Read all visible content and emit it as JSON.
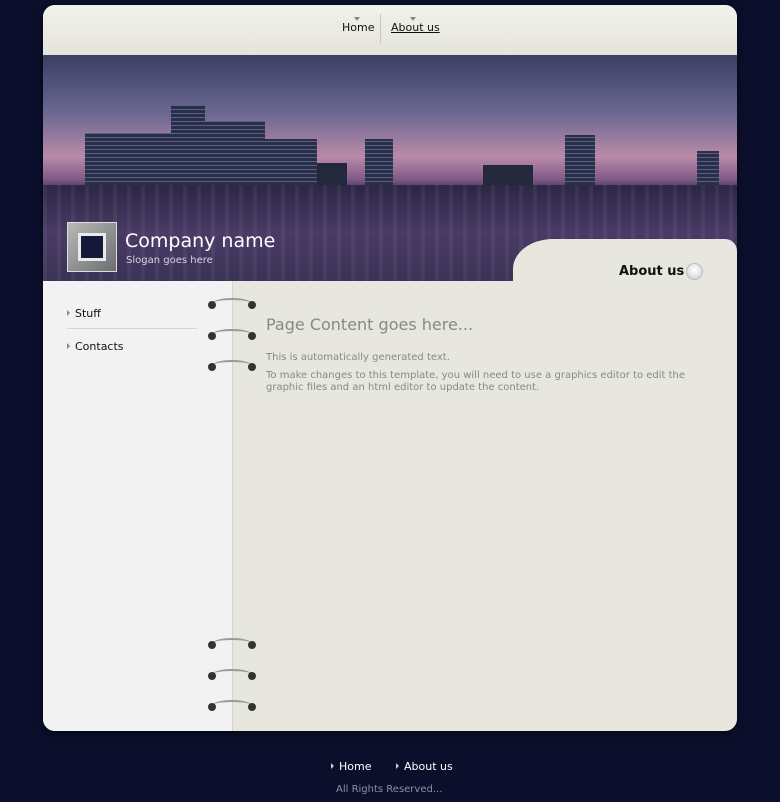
{
  "nav": {
    "home": "Home",
    "about": "About us"
  },
  "brand": {
    "company_name": "Company name",
    "slogan": "Slogan goes here"
  },
  "tab": {
    "title": "About us"
  },
  "sidebar": {
    "items": [
      {
        "label": "Stuff"
      },
      {
        "label": "Contacts"
      }
    ]
  },
  "content": {
    "title": "Page Content goes here...",
    "paragraphs": [
      "This is automatically generated text.",
      "To make changes to this template, you will need to use a graphics editor to edit the graphic files and an html editor to update the content."
    ]
  },
  "footer": {
    "home": "Home",
    "about": "About us",
    "copyright": "All Rights Reserved..."
  },
  "colors": {
    "page_bg": "#0b0f2c",
    "panel_bg": "#e7e7df",
    "sidebar_bg": "#f2f2f2",
    "text_muted": "#888888"
  }
}
